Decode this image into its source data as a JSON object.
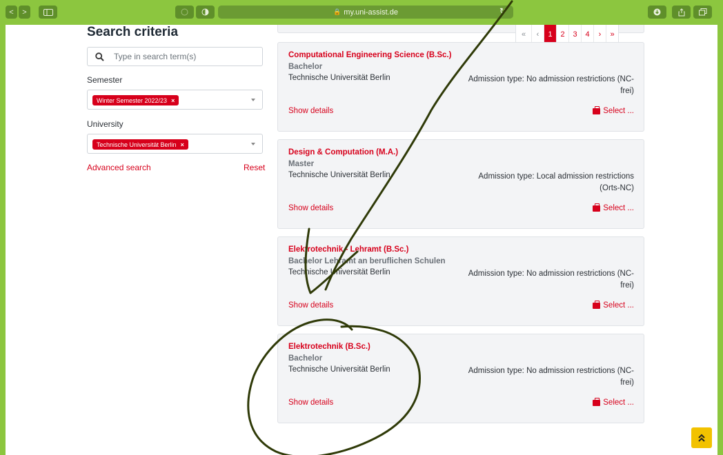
{
  "browser": {
    "url": "my.uni-assist.de",
    "lock_icon": "lock-icon",
    "back": "<",
    "forward": ">"
  },
  "sidebar": {
    "title": "Search criteria",
    "search_placeholder": "Type in search term(s)",
    "semester_label": "Semester",
    "semester_tag": "Winter Semester 2022/23",
    "university_label": "University",
    "university_tag": "Technische Universität Berlin",
    "advanced_search": "Advanced search",
    "reset": "Reset"
  },
  "pagination": {
    "first": "«",
    "prev": "‹",
    "pages": [
      "1",
      "2",
      "3",
      "4"
    ],
    "active_page": "1",
    "next": "›",
    "last": "»"
  },
  "results": [
    {
      "title": "Computational Engineering Science (B.Sc.)",
      "degree": "Bachelor",
      "university": "Technische Universität Berlin",
      "admission": "Admission type: No admission restrictions (NC-frei)",
      "show_details": "Show details",
      "select": "Select ..."
    },
    {
      "title": "Design & Computation (M.A.)",
      "degree": "Master",
      "university": "Technische Universität Berlin",
      "admission": "Admission type: Local admission restrictions (Orts-NC)",
      "show_details": "Show details",
      "select": "Select ..."
    },
    {
      "title": "Elektrotechnik - Lehramt (B.Sc.)",
      "degree": "Bachelor Lehramt an beruflichen Schulen",
      "university": "Technische Universität Berlin",
      "admission": "Admission type: No admission restrictions (NC-frei)",
      "show_details": "Show details",
      "select": "Select ..."
    },
    {
      "title": "Elektrotechnik (B.Sc.)",
      "degree": "Bachelor",
      "university": "Technische Universität Berlin",
      "admission": "Admission type: No admission restrictions (NC-frei)",
      "show_details": "Show details",
      "select": "Select ..."
    }
  ],
  "colors": {
    "accent": "#d7001b",
    "browser_chrome": "#8cc63f",
    "card_bg": "#f3f4f6",
    "annotation_ink": "#2f3a08",
    "scroll_top_button": "#f2c200"
  },
  "scroll_top_icon": "double-chevron-up-icon"
}
